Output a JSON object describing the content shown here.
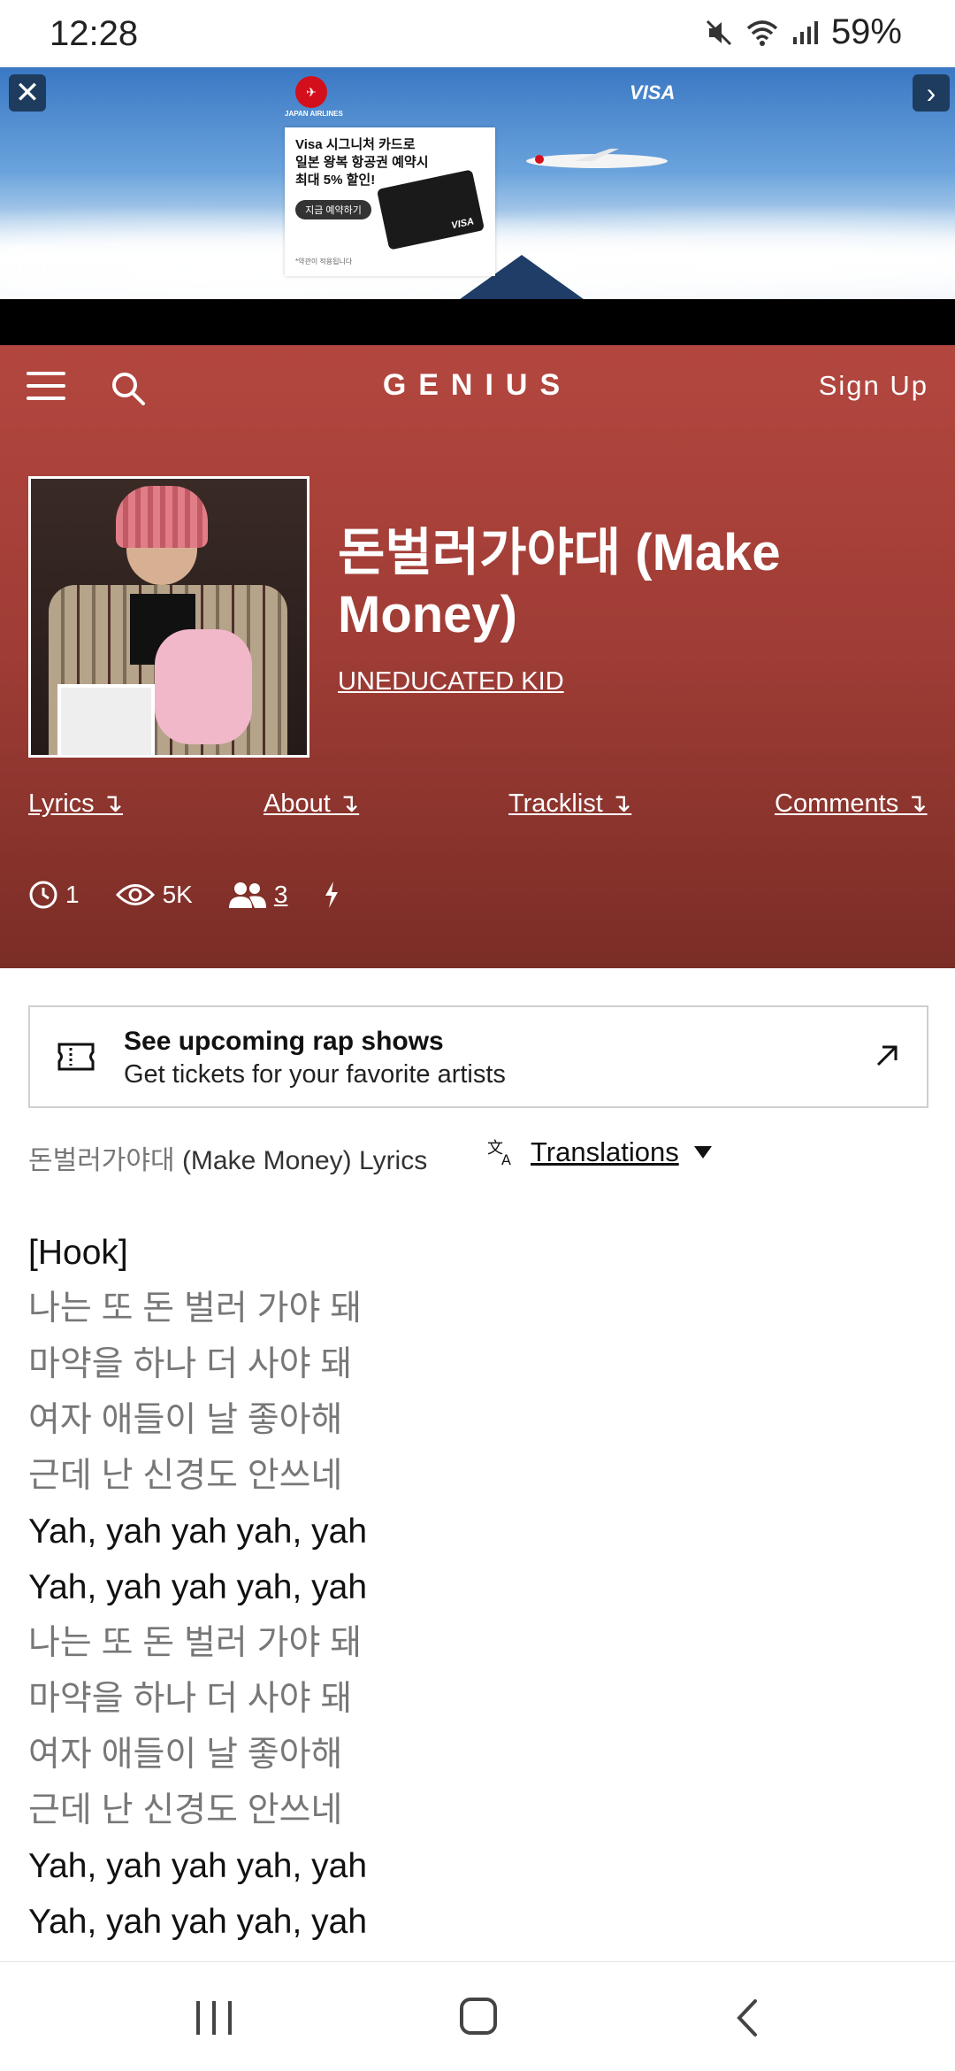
{
  "status_bar": {
    "time": "12:28",
    "battery": "59%",
    "icons": [
      "mute-icon",
      "wifi-icon",
      "signal-icon"
    ]
  },
  "ad": {
    "airline_label": "JAPAN AIRLINES",
    "brand": "VISA",
    "card_lines": [
      "Visa 시그니처 카드로",
      "일본 왕복 항공권 예약시",
      "최대 5% 할인!"
    ],
    "cta": "지금 예약하기",
    "card_brand": "VISA",
    "note": "*약관이 적용됩니다"
  },
  "nav": {
    "logo": "GENIUS",
    "signup": "Sign Up"
  },
  "song": {
    "title": "돈벌러가야대 (Make Money)",
    "artist": "UNEDUCATED KID"
  },
  "tabs": [
    {
      "label": "Lyrics ↴"
    },
    {
      "label": "About ↴"
    },
    {
      "label": "Tracklist ↴"
    },
    {
      "label": "Comments ↴"
    }
  ],
  "stats": {
    "edits": "1",
    "views": "5K",
    "contributors": "3"
  },
  "tickets": {
    "title": "See upcoming rap shows",
    "subtitle": "Get tickets for your favorite artists"
  },
  "lyrics_header": {
    "title_korean": "돈벌러가야대",
    "title_rest": " (Make Money) Lyrics",
    "translations": "Translations"
  },
  "lyrics": [
    "[Hook]",
    "나는 또 돈 벌러 가야 돼",
    "마약을 하나 더 사야 돼",
    "여자 애들이 날 좋아해",
    "근데 난 신경도 안쓰네",
    "Yah, yah yah yah, yah",
    "Yah, yah yah yah, yah",
    "나는 또 돈 벌러 가야 돼",
    "마약을 하나 더 사야 돼",
    "여자 애들이 날 좋아해",
    "근데 난 신경도 안쓰네",
    "Yah, yah yah yah, yah",
    "Yah, yah yah yah, yah"
  ],
  "colors": {
    "hero_top": "#b3473f",
    "hero_bottom": "#7a2d26",
    "korean_text": "#777777"
  }
}
